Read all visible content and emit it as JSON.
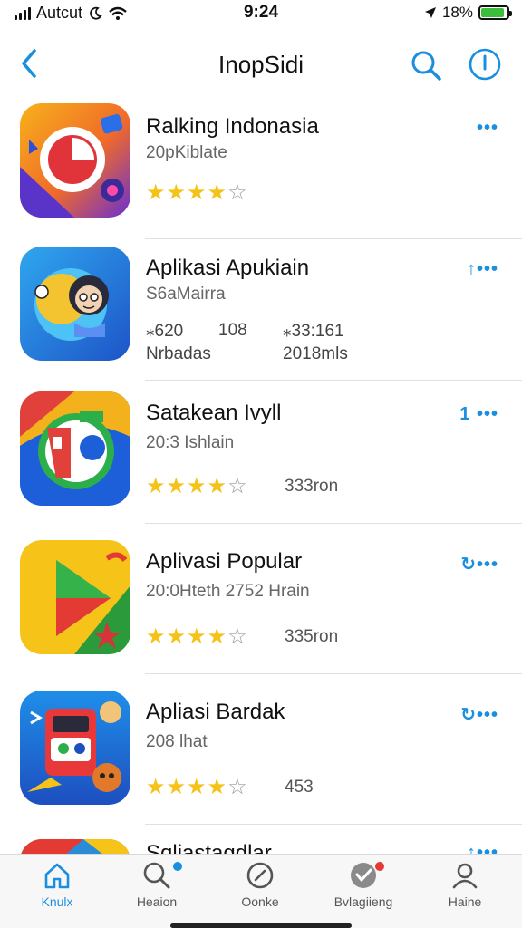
{
  "status_bar": {
    "carrier": "Autcut",
    "time": "9:24",
    "battery_text": "18%",
    "battery_level": 0.9
  },
  "nav": {
    "title": "InopSidi"
  },
  "apps": [
    {
      "name": "Ralking Indonasia",
      "subtitle": "20pKiblate",
      "rating": 4,
      "count": "",
      "action": "•••",
      "stats": null
    },
    {
      "name": "Aplikasi Apukiain",
      "subtitle": "S6aMairra",
      "rating": null,
      "count": "",
      "action": "↑•••",
      "stats": {
        "a_value": "⁎620",
        "a_label": "Nrbadas",
        "b_value": "108",
        "c_value": "⁎33:161",
        "c_label": "2018mls"
      }
    },
    {
      "name": "Satakean Ivyll",
      "subtitle": "20:3 Ishlain",
      "rating": 4,
      "count": "333ron",
      "action": "1 •••",
      "stats": null
    },
    {
      "name": "Aplivasi Popular",
      "subtitle": "20:0Hteth 2752 Hrain",
      "rating": 4,
      "count": "335ron",
      "action": "↻•••",
      "stats": null
    },
    {
      "name": "Apliasi Bardak",
      "subtitle": "208 lhat",
      "rating": 4,
      "count": "453",
      "action": "↻•••",
      "stats": null
    },
    {
      "name": "Sqliastagdlar",
      "subtitle": "",
      "rating": null,
      "count": "",
      "action": "↑•••",
      "stats": null
    }
  ],
  "tabs": [
    {
      "label": "Knulx",
      "icon": "home-icon",
      "active": true
    },
    {
      "label": "Heaion",
      "icon": "search-icon",
      "active": false
    },
    {
      "label": "Oonke",
      "icon": "compass-icon",
      "active": false
    },
    {
      "label": "Bvlagiieng",
      "icon": "heart-icon",
      "active": false
    },
    {
      "label": "Haine",
      "icon": "person-icon",
      "active": false
    }
  ],
  "colors": {
    "accent": "#1a8fe0",
    "star": "#f5c218",
    "badge_blue": "#1a8fe0",
    "badge_red": "#e53935"
  }
}
